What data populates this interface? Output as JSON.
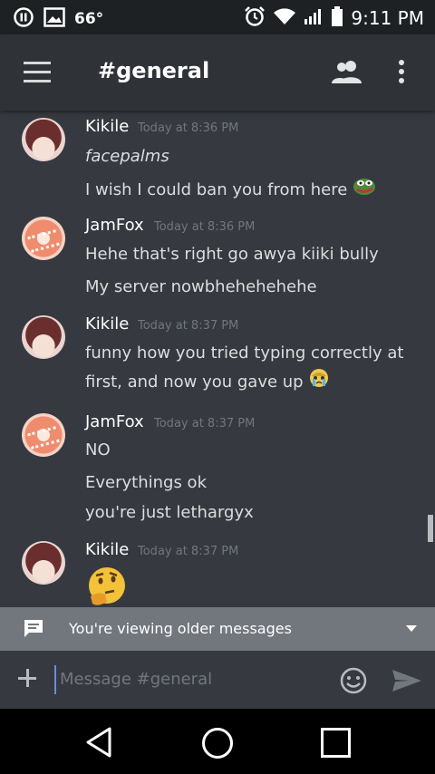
{
  "status_bar": {
    "temperature": "66°",
    "time": "9:11 PM"
  },
  "header": {
    "channel_title": "#general"
  },
  "messages": [
    {
      "user": "Kikile",
      "timestamp": "Today at 8:36 PM",
      "lines": [
        "facepalms",
        "I wish I could ban you from here"
      ]
    },
    {
      "user": "JamFox",
      "timestamp": "Today at 8:36 PM",
      "lines": [
        "Hehe that's right go awya kiiki bully",
        "My server nowbhehehehehe"
      ]
    },
    {
      "user": "Kikile",
      "timestamp": "Today at 8:37 PM",
      "lines": [
        "funny how you tried typing correctly at",
        "first, and now you gave up"
      ]
    },
    {
      "user": "JamFox",
      "timestamp": "Today at 8:37 PM",
      "lines": [
        "NO",
        "Everythings ok",
        "you're just lethargyx"
      ]
    },
    {
      "user": "Kikile",
      "timestamp": "Today at 8:37 PM",
      "lines": []
    }
  ],
  "banner": {
    "text": "You're viewing older messages"
  },
  "composer": {
    "placeholder": "Message #general"
  }
}
